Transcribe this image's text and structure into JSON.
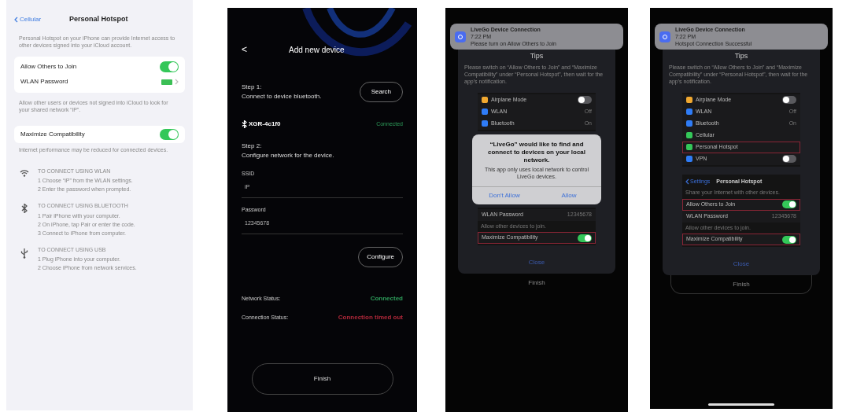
{
  "hotspot": {
    "back": "Cellular",
    "title": "Personal Hotspot",
    "intro": "Personal Hotspot on your iPhone can provide Internet access to other devices signed into your iCloud account.",
    "rows": [
      {
        "label": "Allow Others to Join",
        "kind": "toggle",
        "on": true
      },
      {
        "label": "WLAN Password",
        "kind": "redacted"
      }
    ],
    "join_note": "Allow other users or devices not signed into iCloud to look for your shared network “iP”.",
    "compat": {
      "label": "Maximize Compatibility",
      "on": true
    },
    "compat_note": "Internet performance may be reduced for connected devices.",
    "methods": [
      {
        "kind": "wifi",
        "heading": "TO CONNECT USING WLAN",
        "steps": [
          "1 Choose “iP” from the WLAN settings.",
          "2 Enter the password when prompted."
        ]
      },
      {
        "kind": "bluetooth",
        "heading": "TO CONNECT USING BLUETOOTH",
        "steps": [
          "1 Pair iPhone with your computer.",
          "2 On iPhone, tap Pair or enter the code.",
          "3 Connect to iPhone from computer."
        ]
      },
      {
        "kind": "usb",
        "heading": "TO CONNECT USING USB",
        "steps": [
          "1 Plug iPhone into your computer.",
          "2 Choose iPhone from network services."
        ]
      }
    ]
  },
  "add_device": {
    "back": "<",
    "title": "Add new device",
    "step1": {
      "title": "Step 1:",
      "text": "Connect to device bluetooth."
    },
    "search": "Search",
    "device": {
      "name": "XGR-4c1f0",
      "status": "Connected"
    },
    "step2": {
      "title": "Step 2:",
      "text": "Configure network for the device."
    },
    "fields": [
      {
        "label": "SSID",
        "value": "iP"
      },
      {
        "label": "Password",
        "value": "12345678"
      }
    ],
    "configure": "Configure",
    "statuses": [
      {
        "label": "Network Status:",
        "value": "Connected",
        "color": "#2e9e5b"
      },
      {
        "label": "Connection Status:",
        "value": "Connection timed out",
        "color": "#b0283a"
      }
    ],
    "finish": "Finish"
  },
  "tips_screens": [
    {
      "notification": {
        "title": "LiveGo Device Connection",
        "time": "7:22 PM",
        "text": "Please turn on Allow Others to Join"
      },
      "tips": {
        "title": "Tips",
        "text": "Please switch on “Allow Others to Join” and “Maximize Compatibility” under “Personal Hotspot”, then wait for the app's notification."
      },
      "preview": [
        {
          "label": "Airplane Mode",
          "color": "#f0a830",
          "kind": "toggle",
          "on": false,
          "highlighted": false
        },
        {
          "label": "WLAN",
          "color": "#2f7cf6",
          "kind": "value",
          "value": "Off",
          "highlighted": false
        },
        {
          "label": "Bluetooth",
          "color": "#2f7cf6",
          "kind": "value",
          "value": "On",
          "highlighted": false
        }
      ],
      "alert": {
        "title": "“LiveGo” would like to find and connect to devices on your local network.",
        "text": "This app only uses local network to control LiveGo devices.",
        "buttons": [
          "Don't Allow",
          "Allow"
        ]
      },
      "hotspot_preview": [
        {
          "label": "WLAN Password",
          "kind": "value",
          "value": "12345678",
          "highlighted": false
        },
        {
          "label": "Allow other devices to join.",
          "kind": "note"
        },
        {
          "label": "Maximize Compatibility",
          "kind": "toggle",
          "on": true,
          "highlighted": true
        }
      ],
      "close": "Close",
      "finish": "Finish"
    },
    {
      "notification": {
        "title": "LiveGo Device Connection",
        "time": "7:22 PM",
        "text": "Hotspot Connection Successful"
      },
      "tips": {
        "title": "Tips",
        "text": "Please switch on “Allow Others to Join” and “Maximize Compatibility” under “Personal Hotspot”, then wait for the app's notification."
      },
      "preview": [
        {
          "label": "Airplane Mode",
          "color": "#f0a830",
          "kind": "toggle",
          "on": false,
          "highlighted": false
        },
        {
          "label": "WLAN",
          "color": "#2f7cf6",
          "kind": "value",
          "value": "Off",
          "highlighted": false
        },
        {
          "label": "Bluetooth",
          "color": "#2f7cf6",
          "kind": "value",
          "value": "On",
          "highlighted": false
        },
        {
          "label": "Cellular",
          "color": "#34c759",
          "kind": "plain",
          "highlighted": false
        },
        {
          "label": "Personal Hotspot",
          "color": "#34c759",
          "kind": "plain",
          "highlighted": true
        },
        {
          "label": "VPN",
          "color": "#2f7cf6",
          "kind": "toggle",
          "on": false,
          "highlighted": false
        }
      ],
      "hotspot_header": {
        "back": "Settings",
        "title": "Personal Hotspot"
      },
      "hotspot_preview": [
        {
          "label": "Share your Internet with other devices.",
          "kind": "note"
        },
        {
          "label": "Allow Others to Join",
          "kind": "toggle",
          "on": true,
          "highlighted": true
        },
        {
          "label": "WLAN Password",
          "kind": "value",
          "value": "12345678",
          "highlighted": false
        },
        {
          "label": "Allow other devices to join.",
          "kind": "note"
        },
        {
          "label": "Maximize Compatibility",
          "kind": "toggle",
          "on": true,
          "highlighted": true
        }
      ],
      "close": "Close",
      "finish": "Finish",
      "home_indicator": true
    }
  ]
}
